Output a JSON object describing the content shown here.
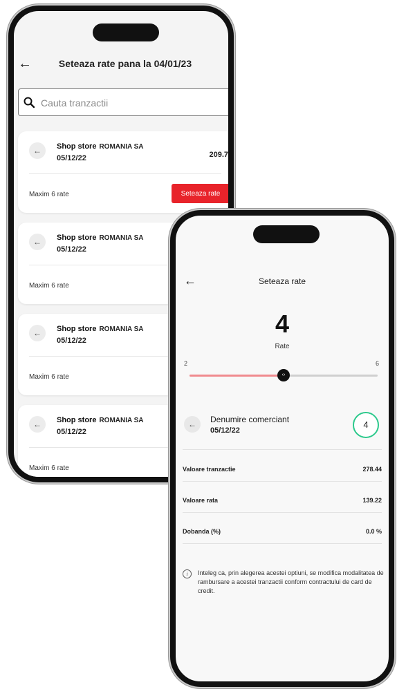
{
  "list_screen": {
    "title": "Seteaza rate pana la 04/01/23",
    "search": {
      "placeholder": "Cauta tranzactii"
    },
    "transactions": [
      {
        "name": "Shop store",
        "merchant": "ROMANIA SA",
        "date": "05/12/22",
        "amount": "209.7",
        "max_prefix": "Maxim",
        "max_count": "6",
        "max_suffix": "rate",
        "button": "Seteaza rate"
      },
      {
        "name": "Shop store",
        "merchant": "ROMANIA SA",
        "date": "05/12/22",
        "amount": "",
        "max_prefix": "Maxim",
        "max_count": "6",
        "max_suffix": "rate",
        "button": ""
      },
      {
        "name": "Shop store",
        "merchant": "ROMANIA SA",
        "date": "05/12/22",
        "amount": "",
        "max_prefix": "Maxim",
        "max_count": "6",
        "max_suffix": "rate",
        "button": ""
      },
      {
        "name": "Shop store",
        "merchant": "ROMANIA SA",
        "date": "05/12/22",
        "amount": "",
        "max_prefix": "Maxim",
        "max_count": "6",
        "max_suffix": "rate",
        "button": ""
      }
    ]
  },
  "detail_screen": {
    "title": "Seteaza rate",
    "selected_count": "4",
    "count_label": "Rate",
    "slider": {
      "min": 2,
      "max": 6,
      "value": 4,
      "min_label": "2",
      "max_label": "6",
      "thumb_symbol": "‹›"
    },
    "merchant": {
      "name": "Denumire comerciant",
      "date": "05/12/22",
      "badge": "4"
    },
    "rows": [
      {
        "label": "Valoare tranzactie",
        "value": "278.44"
      },
      {
        "label": "Valoare rata",
        "value": "139.22"
      },
      {
        "label": "Dobanda (%)",
        "value": "0.0 %"
      }
    ],
    "info_text": "Inteleg ca, prin alegerea acestei optiuni, se modifica modalitatea de rambursare a acestei tranzactii conform contractului de card de credit."
  },
  "icons": {
    "back": "back-arrow-icon",
    "search": "search-icon",
    "info": "info-icon",
    "transaction": "arrow-left-circle-icon"
  },
  "colors": {
    "accent_red": "#e8232a",
    "slider_fill": "#f08a8e",
    "badge_green": "#2cc98c"
  }
}
